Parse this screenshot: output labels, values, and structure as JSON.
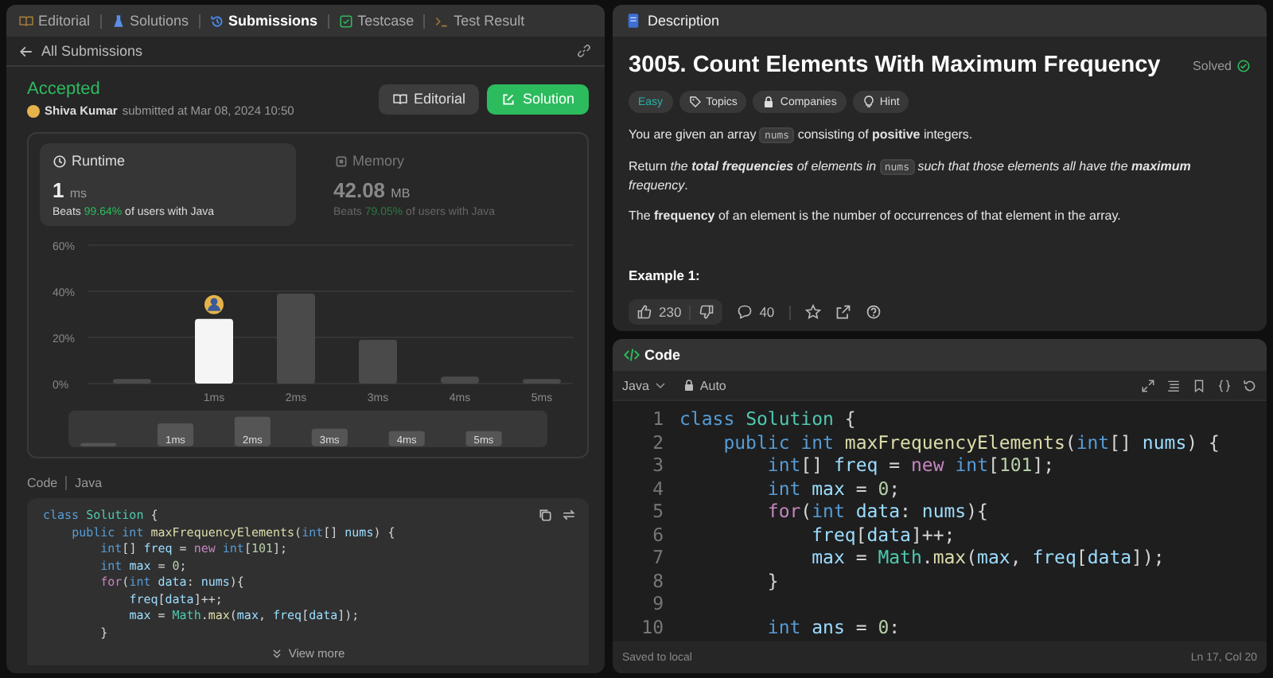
{
  "left_tabs": [
    {
      "label": "Editorial",
      "kind": "book",
      "selected": false
    },
    {
      "label": "Solutions",
      "kind": "flask",
      "selected": false
    },
    {
      "label": "Submissions",
      "kind": "history",
      "selected": true
    },
    {
      "label": "Testcase",
      "kind": "check",
      "selected": false
    },
    {
      "label": "Test Result",
      "kind": "terminal",
      "selected": false
    }
  ],
  "back_link": "All Submissions",
  "submission": {
    "status": "Accepted",
    "author": "Shiva Kumar",
    "submitted": "submitted at Mar 08, 2024 10:50",
    "buttons": [
      {
        "label": "Editorial",
        "kind": "secondary"
      },
      {
        "label": "Solution",
        "kind": "primary"
      }
    ]
  },
  "metrics": [
    {
      "label": "Runtime",
      "kind": "clock",
      "value": "1",
      "unit": "ms",
      "beats": "Beats",
      "percent": "99.64%",
      "suffix": "of users with Java",
      "selected": true
    },
    {
      "label": "Memory",
      "kind": "chip",
      "value": "42.08",
      "unit": "MB",
      "beats": "Beats",
      "percent": "79.05%",
      "suffix": "of users with Java",
      "selected": false
    }
  ],
  "runtime_chart": {
    "chart_data": {
      "type": "bar",
      "categories": [
        null,
        "1ms",
        "2ms",
        "3ms",
        "4ms",
        "5ms"
      ],
      "values": [
        2,
        28,
        39,
        19,
        3,
        2
      ],
      "ylim": [
        0,
        60
      ],
      "yticks": [
        {
          "value": 0,
          "label": "0%"
        },
        {
          "value": 20,
          "label": "20%"
        },
        {
          "value": 40,
          "label": "40%"
        },
        {
          "value": 60,
          "label": "60%"
        }
      ]
    },
    "bars": [
      {
        "selected": false
      },
      {
        "selected": true
      },
      {
        "selected": false
      },
      {
        "selected": false
      },
      {
        "selected": false
      },
      {
        "selected": false
      }
    ]
  },
  "overview": {
    "labels": [
      "1ms",
      "2ms",
      "3ms",
      "4ms",
      "5ms"
    ]
  },
  "code_view": {
    "label": "Code",
    "language": "Java",
    "more": "View more",
    "lines": [
      "class Solution {",
      "    public int maxFrequencyElements(int[] nums) {",
      "        int[] freq = new int[101];",
      "        int max = 0;",
      "        for(int data: nums){",
      "            freq[data]++;",
      "            max = Math.max(max, freq[data]);",
      "        }"
    ]
  },
  "description": {
    "tab": "Description",
    "title": "3005. Count Elements With Maximum Frequency",
    "status": "Solved",
    "tags": [
      {
        "label": "Easy",
        "kind": "difficulty"
      },
      {
        "label": "Topics",
        "kind": "tag"
      },
      {
        "label": "Companies",
        "kind": "lock"
      },
      {
        "label": "Hint",
        "kind": "bulb"
      }
    ],
    "paragraphs": [
      [
        {
          "t": "You are given an array "
        },
        {
          "t": "nums",
          "code": true
        },
        {
          "t": " consisting of **positive** integers."
        }
      ],
      [
        {
          "t": "Return "
        },
        {
          "t": "the **total frequencies** of elements in ",
          "italic": true
        },
        {
          "t": "nums",
          "code": true
        },
        {
          "t": " such that those elements all have the **maximum** frequency",
          "italic": true
        },
        {
          "t": "."
        }
      ],
      [
        {
          "t": "The **frequency** of an element is the number of occurrences of that element in the array."
        }
      ]
    ],
    "example": "Example 1:",
    "likes": "230",
    "comments": "40"
  },
  "editor": {
    "tab": "Code",
    "language": "Java",
    "mode": "Auto",
    "lines": [
      {
        "n": "1",
        "code": "class Solution {"
      },
      {
        "n": "2",
        "code": "    public int maxFrequencyElements(int[] nums) {"
      },
      {
        "n": "3",
        "code": "        int[] freq = new int[101];"
      },
      {
        "n": "4",
        "code": "        int max = 0;"
      },
      {
        "n": "5",
        "code": "        for(int data: nums){"
      },
      {
        "n": "6",
        "code": "            freq[data]++;"
      },
      {
        "n": "7",
        "code": "            max = Math.max(max, freq[data]);"
      },
      {
        "n": "8",
        "code": "        }"
      },
      {
        "n": "9"
      },
      {
        "n": "10",
        "code": "        int ans = 0:"
      }
    ],
    "status": "Saved to local",
    "cursor": "Ln 17, Col 20"
  }
}
